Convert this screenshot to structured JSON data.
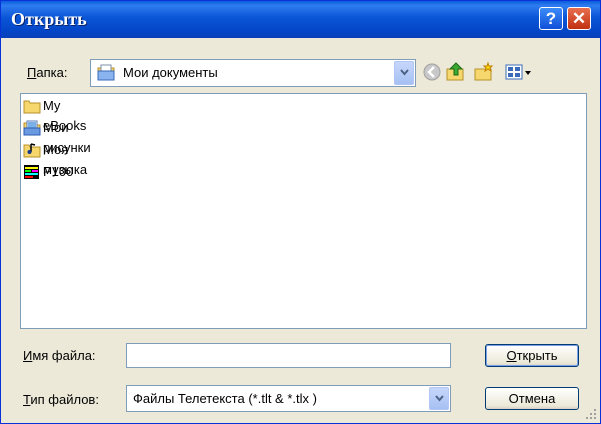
{
  "window": {
    "title": "Открыть",
    "help_label": "?",
    "close_label": "✕"
  },
  "folder": {
    "label_first": "П",
    "label_rest": "апка:",
    "current": "Мои документы"
  },
  "toolbar": {
    "back_icon": "back-arrow-icon",
    "up_icon": "up-folder-icon",
    "new_folder_icon": "new-folder-icon",
    "views_icon": "view-menu-icon"
  },
  "files": [
    {
      "name": "My eBooks",
      "icon": "folder-icon"
    },
    {
      "name": "Мои рисунки",
      "icon": "pictures-folder-icon"
    },
    {
      "name": "Моя музыка",
      "icon": "music-folder-icon"
    },
    {
      "name": "P100",
      "icon": "teletext-file-icon"
    }
  ],
  "filename": {
    "label_first": "И",
    "label_rest": "мя файла:",
    "value": ""
  },
  "filetype": {
    "label_first": "Т",
    "label_rest": "ип файлов:",
    "value": "Файлы Телетекста (*.tlt & *.tlx )"
  },
  "buttons": {
    "open_first": "О",
    "open_rest": "ткрыть",
    "cancel": "Отмена"
  },
  "colors": {
    "titlebar": "#0a55d6",
    "dialog_bg": "#ece9d8",
    "close_btn": "#c03010"
  }
}
